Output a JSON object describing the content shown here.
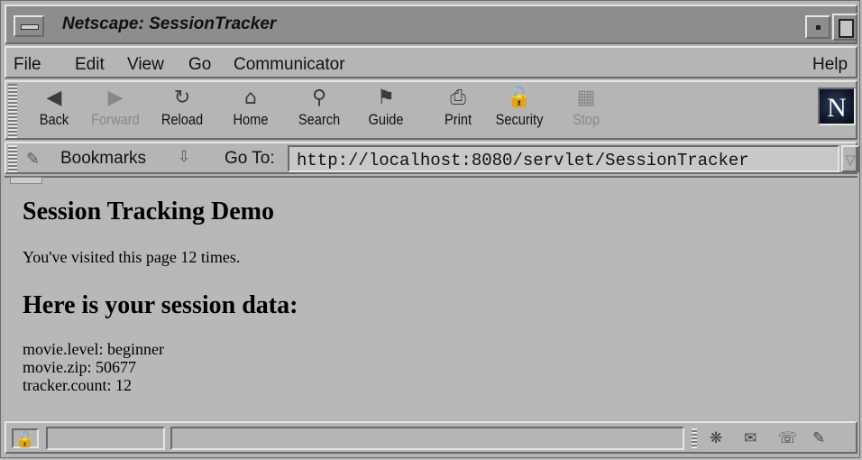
{
  "window": {
    "title": "Netscape: SessionTracker"
  },
  "menu": {
    "file": "File",
    "edit": "Edit",
    "view": "View",
    "go": "Go",
    "communicator": "Communicator",
    "help": "Help"
  },
  "toolbar": {
    "back": "Back",
    "forward": "Forward",
    "reload": "Reload",
    "home": "Home",
    "search": "Search",
    "guide": "Guide",
    "print": "Print",
    "security": "Security",
    "stop": "Stop",
    "logo": "N"
  },
  "location": {
    "bookmarks": "Bookmarks",
    "goto_label": "Go To:",
    "url": "http://localhost:8080/servlet/SessionTracker"
  },
  "page": {
    "heading": "Session Tracking Demo",
    "visits": "You've visited this page 12 times.",
    "subheading": "Here is your session data:",
    "data": [
      "movie.level: beginner",
      "movie.zip: 50677",
      "tracker.count: 12"
    ]
  },
  "icons": {
    "back": "back-arrow-icon",
    "forward": "forward-arrow-icon",
    "reload": "reload-icon",
    "home": "home-icon",
    "search": "search-icon",
    "guide": "guide-icon",
    "print": "printer-icon",
    "security": "padlock-icon",
    "stop": "stop-icon"
  }
}
